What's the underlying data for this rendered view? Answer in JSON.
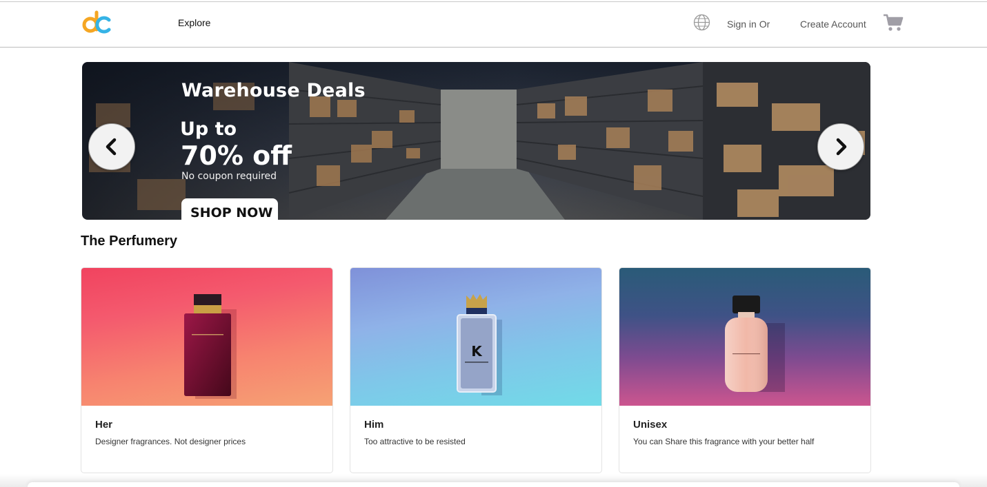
{
  "header": {
    "logo_icon": "dc-logo-icon",
    "explore_label": "Explore",
    "globe_icon": "globe-icon",
    "signin_label": "Sign in Or",
    "create_account_label": "Create Account",
    "cart_icon": "cart-icon"
  },
  "banner": {
    "title": "Warehouse Deals",
    "upto": "Up to",
    "discount": "70% off",
    "subtitle": "No coupon required",
    "cta_label": "SHOP NOW",
    "prev_icon": "chevron-left-icon",
    "next_icon": "chevron-right-icon"
  },
  "section": {
    "title": "The Perfumery"
  },
  "cards": [
    {
      "name": "Her",
      "description": "Designer fragrances. Not designer prices"
    },
    {
      "name": "Him",
      "description": "Too attractive to be resisted"
    },
    {
      "name": "Unisex",
      "description": "You can Share this fragrance with your better half"
    }
  ],
  "colors": {
    "logo_orange": "#f5a623",
    "logo_blue": "#35b3e6",
    "her_bg": "#f45a6e",
    "him_bg": "#8fb2e8",
    "unisex_bg": "#7d4b90"
  }
}
